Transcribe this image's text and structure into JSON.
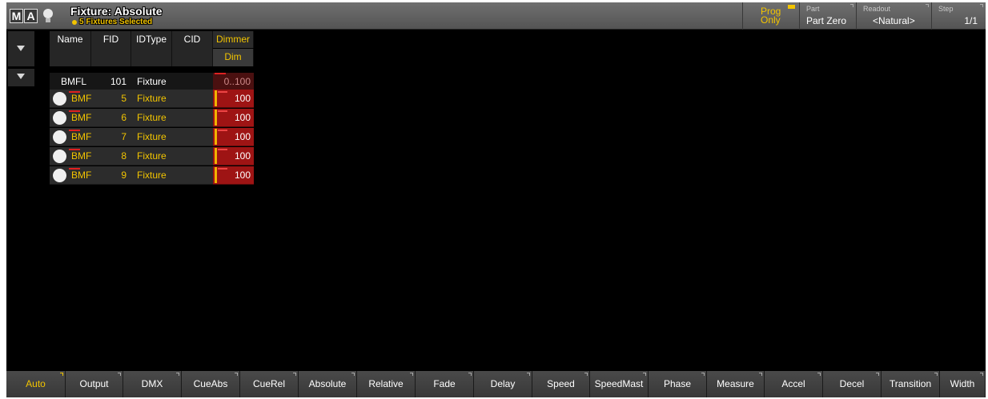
{
  "titlebar": {
    "logo": [
      "M",
      "A"
    ],
    "title": "Fixture: Absolute",
    "subtitle": "5 Fixtures Selected",
    "prog": "Prog Only",
    "part": {
      "caption": "Part",
      "value": "Part Zero"
    },
    "readout": {
      "caption": "Readout",
      "value": "<Natural>"
    },
    "step": {
      "caption": "Step",
      "value": "1/1"
    }
  },
  "sheet": {
    "headers": {
      "name": "Name",
      "fid": "FID",
      "idtype": "IDType",
      "cid": "CID",
      "attribute": "Dimmer",
      "subattribute": "Dim"
    },
    "group": {
      "name": "BMFL",
      "fid": "101",
      "idtype": "Fixture",
      "cid": "",
      "value": "0..100"
    },
    "fixtures": [
      {
        "name": "BMF",
        "fid": "5",
        "idtype": "Fixture",
        "cid": "",
        "value": "100"
      },
      {
        "name": "BMF",
        "fid": "6",
        "idtype": "Fixture",
        "cid": "",
        "value": "100"
      },
      {
        "name": "BMF",
        "fid": "7",
        "idtype": "Fixture",
        "cid": "",
        "value": "100"
      },
      {
        "name": "BMF",
        "fid": "8",
        "idtype": "Fixture",
        "cid": "",
        "value": "100"
      },
      {
        "name": "BMF",
        "fid": "9",
        "idtype": "Fixture",
        "cid": "",
        "value": "100"
      }
    ]
  },
  "tabs": [
    "Auto",
    "Output",
    "DMX",
    "CueAbs",
    "CueRel",
    "Absolute",
    "Relative",
    "Fade",
    "Delay",
    "Speed",
    "SpeedMast",
    "Phase",
    "Measure",
    "Accel",
    "Decel",
    "Transition",
    "Width"
  ],
  "colors": {
    "accent": "#f2c400",
    "dimmer_value": "#9e1414",
    "background": "#000000"
  }
}
